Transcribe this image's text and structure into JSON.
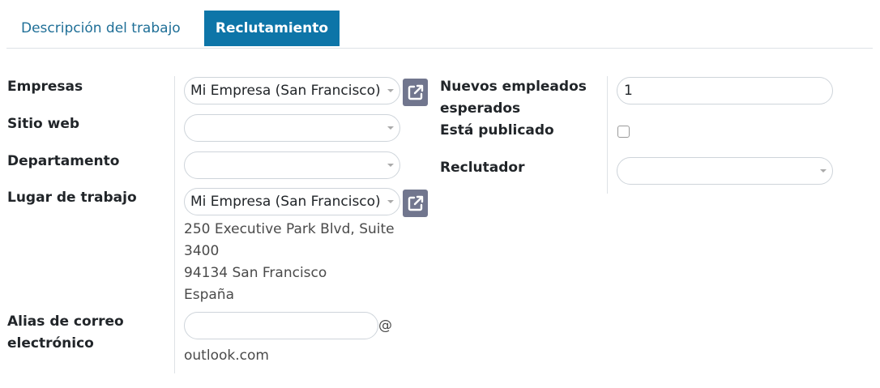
{
  "tabs": {
    "description": "Descripción del trabajo",
    "recruitment": "Reclutamiento"
  },
  "fields": {
    "companies": {
      "label": "Empresas",
      "value": "Mi Empresa (San Francisco)"
    },
    "website": {
      "label": "Sitio web",
      "value": ""
    },
    "department": {
      "label": "Departamento",
      "value": ""
    },
    "workplace": {
      "label": "Lugar de trabajo",
      "value": "Mi Empresa (San Francisco)",
      "address_line1": "250 Executive Park Blvd, Suite",
      "address_line2": "3400",
      "address_line3": "94134 San Francisco",
      "address_line4": "España"
    },
    "email_alias": {
      "label_line1": "Alias de correo",
      "label_line2": "electrónico",
      "value": "",
      "at": "@",
      "domain": "outlook.com"
    },
    "expected_new_employees": {
      "label_line1": "Nuevos empleados",
      "label_line2": "esperados",
      "value": "1"
    },
    "is_published": {
      "label": "Está publicado",
      "checked": false
    },
    "recruiter": {
      "label": "Reclutador",
      "value": ""
    }
  },
  "icons": {
    "external": "external-link-icon",
    "caret": "caret-down-icon"
  }
}
